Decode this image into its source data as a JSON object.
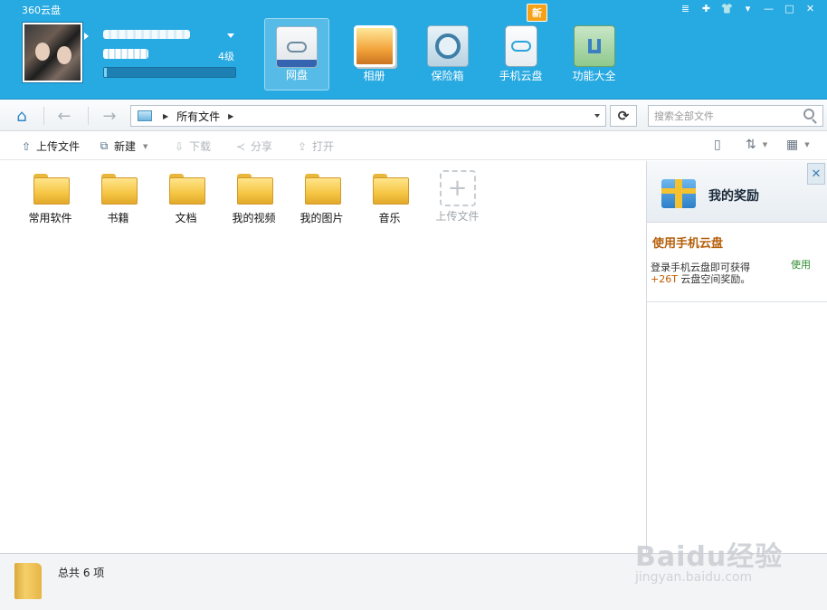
{
  "app": {
    "title": "360云盘"
  },
  "window_controls": [
    "≣",
    "✚",
    "👕",
    "▾",
    "—",
    "□",
    "✕"
  ],
  "user": {
    "level": "4级",
    "storage_used_fraction": 0.02
  },
  "nav": [
    {
      "label": "网盘",
      "icon": "cloud-disk-icon",
      "active": true
    },
    {
      "label": "相册",
      "icon": "photo-album-icon"
    },
    {
      "label": "保险箱",
      "icon": "safe-icon"
    },
    {
      "label": "手机云盘",
      "icon": "phone-cloud-icon",
      "badge": "新"
    },
    {
      "label": "功能大全",
      "icon": "toolbox-icon"
    }
  ],
  "address": {
    "path": "所有文件",
    "search_placeholder": "搜索全部文件"
  },
  "toolbar": {
    "upload": "上传文件",
    "new": "新建",
    "download": "下载",
    "share": "分享",
    "open": "打开"
  },
  "files": [
    {
      "name": "常用软件"
    },
    {
      "name": "书籍"
    },
    {
      "name": "文档"
    },
    {
      "name": "我的视频"
    },
    {
      "name": "我的图片"
    },
    {
      "name": "音乐"
    }
  ],
  "upload_tile": {
    "label": "上传文件"
  },
  "rewards": {
    "title": "我的奖励",
    "task_title": "使用手机云盘",
    "task_action": "使用",
    "task_desc_line1": "登录手机云盘即可获得",
    "task_desc_highlight": "+26T",
    "task_desc_line2": " 云盘空间奖励。"
  },
  "status": {
    "summary": "总共 6 项"
  },
  "watermark": {
    "main": "Baidu经验",
    "sub": "jingyan.baidu.com"
  }
}
